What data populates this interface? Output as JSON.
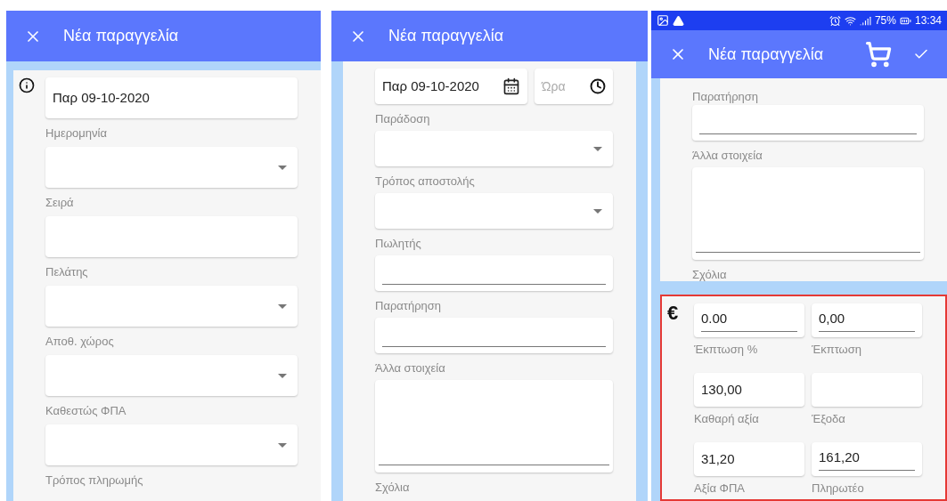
{
  "panels": [
    {
      "app_bar": {
        "title": "Νέα παραγγελία",
        "cart": false,
        "confirm": false
      },
      "cards": [
        {
          "highlighted": false,
          "info_icon": true,
          "kind": "list",
          "fields": [
            {
              "kind": "text",
              "value": "Παρ 09-10-2020",
              "label": "Ημερομηνία",
              "underlined": false
            },
            {
              "kind": "dropdown",
              "label": "Σειρά"
            },
            {
              "kind": "text",
              "label": "Πελάτης",
              "underlined": false
            },
            {
              "kind": "dropdown",
              "label": "Αποθ. χώρος"
            },
            {
              "kind": "dropdown",
              "label": "Καθεστώς ΦΠΑ"
            },
            {
              "kind": "dropdown",
              "label": "Τρόπος πληρωμής"
            }
          ]
        }
      ]
    },
    {
      "app_bar": {
        "title": "Νέα παραγγελία",
        "cart": false,
        "confirm": false
      },
      "cards": [
        {
          "highlighted": false,
          "info_icon": false,
          "kind": "list",
          "fields": [
            {
              "kind": "datetime",
              "value": "Παρ 09-10-2020",
              "placeholder": "Ώρα",
              "label": "Παράδοση"
            },
            {
              "kind": "dropdown",
              "label": "Τρόπος αποστολής"
            },
            {
              "kind": "dropdown",
              "label": "Πωλητής"
            },
            {
              "kind": "text",
              "label": "Παρατήρηση",
              "underlined": true
            },
            {
              "kind": "text",
              "label": "Άλλα στοιχεία",
              "underlined": true
            },
            {
              "kind": "textarea",
              "label": "Σχόλια"
            }
          ]
        }
      ]
    },
    {
      "status_bar": {
        "battery": "75%",
        "time": "13:34"
      },
      "app_bar": {
        "title": "Νέα παραγγελία",
        "cart": true,
        "confirm": true
      },
      "cards": [
        {
          "highlighted": false,
          "info_icon": false,
          "kind": "list",
          "fields": [
            {
              "kind": "label_only",
              "label": "Παρατήρηση"
            },
            {
              "kind": "text",
              "label": "Άλλα στοιχεία",
              "underlined": true
            },
            {
              "kind": "textarea",
              "label": "Σχόλια"
            }
          ]
        },
        {
          "highlighted": true,
          "info_icon": false,
          "leading_symbol": "€",
          "kind": "grid",
          "fields": [
            {
              "kind": "text",
              "value": "0.00",
              "label": "Έκπτωση %",
              "underlined": true
            },
            {
              "kind": "text",
              "value": "0,00",
              "label": "Έκπτωση",
              "underlined": true
            },
            {
              "kind": "text",
              "value": "130,00",
              "label": "Καθαρή αξία",
              "underlined": false
            },
            {
              "kind": "text",
              "label": "Έξοδα",
              "underlined": false
            },
            {
              "kind": "text",
              "value": "31,20",
              "label": "Αξία ΦΠΑ",
              "underlined": false
            },
            {
              "kind": "text",
              "value": "161,20",
              "label": "Πληρωτέο",
              "underlined": true
            }
          ]
        }
      ]
    }
  ]
}
